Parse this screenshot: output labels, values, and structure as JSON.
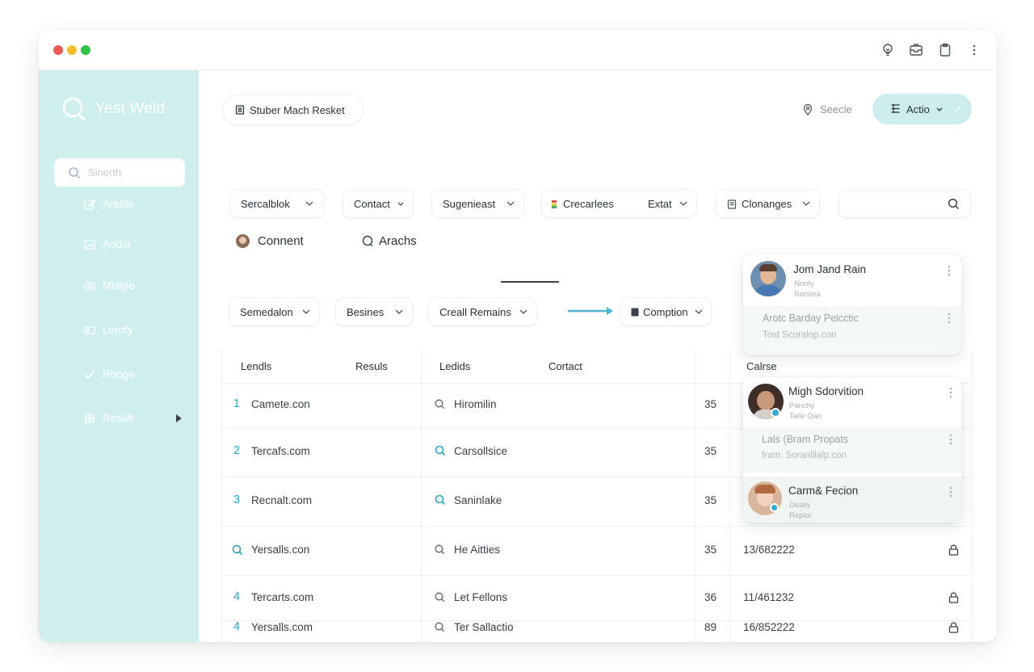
{
  "colors": {
    "sidebar_bg": "#cfeeee",
    "accent": "#28a3c6",
    "action_bg": "#cdeced",
    "window_red": "#f05a52",
    "window_yellow": "#f5bd2f",
    "window_green": "#2ec445"
  },
  "titlebar": {
    "icons": [
      "lightbulb-icon",
      "inbox-icon",
      "clipboard-icon",
      "more-vertical-icon"
    ]
  },
  "sidebar": {
    "logo_text": "Yest Weld",
    "search_placeholder": "Sinorth",
    "items": [
      {
        "label": "Arable",
        "icon": "edit-icon"
      },
      {
        "label": "Aodia",
        "icon": "image-icon"
      },
      {
        "label": "Mlagle",
        "icon": "camera-icon"
      },
      {
        "label": "Lerofy",
        "icon": "card-icon"
      },
      {
        "label": "Rooge",
        "icon": "check-icon"
      },
      {
        "label": "Result",
        "icon": "grid-icon"
      }
    ]
  },
  "header": {
    "doc_chip": "Stuber Mach Resket",
    "location_label": "Seecle",
    "action_label": "Actio"
  },
  "filters": {
    "row1": [
      "Sercalblok",
      "Contact",
      "Sugenieast",
      "Crecarlees",
      "Extat",
      "Clonanges"
    ],
    "search_value": ""
  },
  "tabs": [
    "Connent",
    "Arachs"
  ],
  "filters2": [
    "Semedalon",
    "Besines",
    "Creall Remains",
    "Comption"
  ],
  "table": {
    "headers": [
      "Lendls",
      "Resuls",
      "Ledids",
      "Cortact",
      "Calrse"
    ],
    "rows": [
      {
        "rank": "1",
        "site": "Camete.con",
        "query": "Hiromilin",
        "num": "35",
        "date": "",
        "lock": false
      },
      {
        "rank": "2",
        "site": "Tercafs.com",
        "query": "Carsollsice",
        "num": "35",
        "date": "",
        "lock": false
      },
      {
        "rank": "3",
        "site": "Recnalt.com",
        "query": "Saninlake",
        "num": "35",
        "date": "",
        "lock": false
      },
      {
        "rank": "Q",
        "site": "Yersalls.con",
        "query": "He Aitties",
        "num": "35",
        "date": "13/682222",
        "lock": true
      },
      {
        "rank": "4",
        "site": "Tercarts.com",
        "query": "Let Fellons",
        "num": "36",
        "date": "11/461232",
        "lock": true
      },
      {
        "rank": "4",
        "site": "Yersalls.com",
        "query": "Ter Sallactio",
        "num": "89",
        "date": "16/852222",
        "lock": true
      }
    ]
  },
  "contacts": [
    {
      "name": "Jom Jand Rain",
      "line1": "Nonty",
      "line2": "Rersiea",
      "extra_title": "Arotc Barday Pelcctic",
      "extra_sub": "Tost Scoralop.con"
    },
    {
      "name": "Migh Sdorvition",
      "line1": "Panchy",
      "line2": "Taile Oari",
      "extra_title": "Lals (Bram Propats",
      "extra_sub": "fram. Soranlllalp.con"
    },
    {
      "name": "Carm& Fecion",
      "line1": "Dealiy",
      "line2": "Reploi"
    }
  ]
}
